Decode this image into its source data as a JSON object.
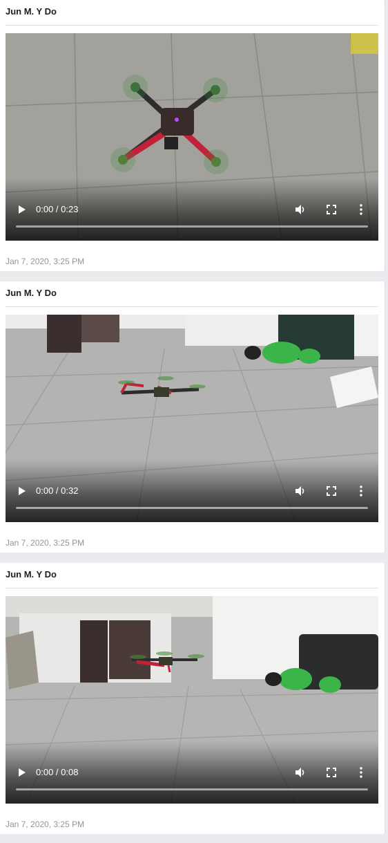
{
  "posts": [
    {
      "author": "Jun M. Y Do",
      "video": {
        "time_display": "0:00 / 0:23"
      },
      "timestamp": "Jan 7, 2020, 3:25 PM"
    },
    {
      "author": "Jun M. Y Do",
      "video": {
        "time_display": "0:00 / 0:32"
      },
      "timestamp": "Jan 7, 2020, 3:25 PM"
    },
    {
      "author": "Jun M. Y Do",
      "video": {
        "time_display": "0:00 / 0:08"
      },
      "timestamp": "Jan 7, 2020, 3:25 PM"
    }
  ],
  "colors": {
    "page_bg": "#e9ebee",
    "card_bg": "#ffffff",
    "muted_text": "#90949c"
  },
  "icons": [
    "play-icon",
    "volume-icon",
    "fullscreen-icon",
    "more-options-icon"
  ]
}
